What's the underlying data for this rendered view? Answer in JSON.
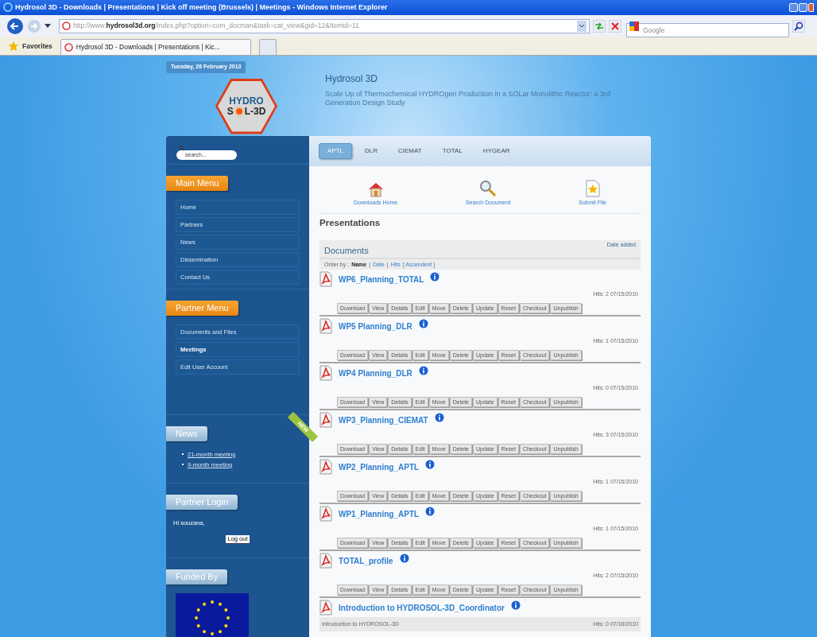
{
  "browser": {
    "title": "Hydrosol 3D - Downloads | Presentations | Kick off meeting (Brussels) | Meetings - Windows Internet Explorer",
    "address": "http://www.**hydrosol3d.org**/index.php?option=com_docman&task=cat_view&gid=12&Itemid=11",
    "search_placeholder": "Google",
    "favorites": "Favorites",
    "tabs": [
      {
        "label": "Hydrosol 3D - Downloads | Presentations | Kic...",
        "selected": true
      }
    ]
  },
  "site": {
    "date": "Tuesday, 26 February 2013",
    "logo_top": "HYDRO",
    "logo_left": "S",
    "logo_right": "L-3D",
    "title": "Hydrosol 3D",
    "subtitle": "Scale Up of Thermochemical HYDROgen Production in a SOLar Monolithic Reactor: a 3rd Generation Design Study"
  },
  "sidebar": {
    "search_placeholder": "search...",
    "modules": [
      {
        "kind": "menu",
        "title": "Main Menu",
        "items": [
          {
            "label": "Home",
            "selected": false
          },
          {
            "label": "Partners",
            "selected": false
          },
          {
            "label": "News",
            "selected": false
          },
          {
            "label": "Dissemination",
            "selected": false
          },
          {
            "label": "Contact Us",
            "selected": false
          }
        ]
      },
      {
        "kind": "menu",
        "title": "Partner Menu",
        "items": [
          {
            "label": "Documents and Files",
            "selected": false
          },
          {
            "label": "Meetings",
            "selected": true
          },
          {
            "label": "Edit User Account",
            "selected": false
          }
        ]
      },
      {
        "kind": "news",
        "title": "News",
        "ribbon": "NEW",
        "items": [
          "21-month meeting",
          "9-month meeting"
        ]
      },
      {
        "kind": "login",
        "title": "Partner Login",
        "greeting": "Hi souzana,",
        "button": "Log out"
      },
      {
        "kind": "funded",
        "title": "Funded By"
      }
    ]
  },
  "content": {
    "tabs": [
      {
        "label": "APTL",
        "selected": true
      },
      {
        "label": "DLR",
        "selected": false
      },
      {
        "label": "CIEMAT",
        "selected": false
      },
      {
        "label": "TOTAL",
        "selected": false
      },
      {
        "label": "HYGEAR",
        "selected": false
      }
    ],
    "actions": [
      {
        "kind": "home",
        "label": "Downloads Home"
      },
      {
        "kind": "search",
        "label": "Search Document"
      },
      {
        "kind": "submit",
        "label": "Submit File"
      }
    ],
    "heading": "Presentations",
    "category": "Documents",
    "sort_label": "Date added",
    "order_by": {
      "label": "Order by :",
      "separators": [
        "|",
        "|"
      ],
      "options": [
        {
          "label": "Name",
          "selected": true
        },
        {
          "label": "Date",
          "selected": false
        },
        {
          "label": "Hits",
          "selected": false
        }
      ],
      "direction": "[ Ascendent ]"
    },
    "documents": [
      {
        "title": "WP6_Planning_TOTAL",
        "hits": "Hits: 2 07/15/2010",
        "buttons": [
          "Download",
          "View",
          "Details",
          "Edit",
          "Move",
          "Delete",
          "Update",
          "Reset",
          "Checkout",
          "Unpublish"
        ]
      },
      {
        "title": "WP5 Planning_DLR",
        "hits": "Hits: 1 07/15/2010",
        "buttons": [
          "Download",
          "View",
          "Details",
          "Edit",
          "Move",
          "Delete",
          "Update",
          "Reset",
          "Checkout",
          "Unpublish"
        ]
      },
      {
        "title": "WP4 Planning_DLR",
        "hits": "Hits: 0 07/15/2010",
        "buttons": [
          "Download",
          "View",
          "Details",
          "Edit",
          "Move",
          "Delete",
          "Update",
          "Reset",
          "Checkout",
          "Unpublish"
        ]
      },
      {
        "title": "WP3_Planning_CIEMAT",
        "hits": "Hits: 3 07/15/2010",
        "buttons": [
          "Download",
          "View",
          "Details",
          "Edit",
          "Move",
          "Delete",
          "Update",
          "Reset",
          "Checkout",
          "Unpublish"
        ]
      },
      {
        "title": "WP2_Planning_APTL",
        "hits": "Hits: 1 07/15/2010",
        "buttons": [
          "Download",
          "View",
          "Details",
          "Edit",
          "Move",
          "Delete",
          "Update",
          "Reset",
          "Checkout",
          "Unpublish"
        ]
      },
      {
        "title": "WP1_Planning_APTL",
        "hits": "Hits: 1 07/15/2010",
        "buttons": [
          "Download",
          "View",
          "Details",
          "Edit",
          "Move",
          "Delete",
          "Update",
          "Reset",
          "Checkout",
          "Unpublish"
        ]
      },
      {
        "title": "TOTAL_profile",
        "hits": "Hits: 2 07/15/2010",
        "buttons": [
          "Download",
          "View",
          "Details",
          "Edit",
          "Move",
          "Delete",
          "Update",
          "Reset",
          "Checkout",
          "Unpublish"
        ]
      },
      {
        "title": "Introduction to HYDROSOL-3D_Coordinator",
        "description": "Introduction to HYDROSOL-3D",
        "hits": "Hits: 0 07/16/2010"
      }
    ]
  }
}
